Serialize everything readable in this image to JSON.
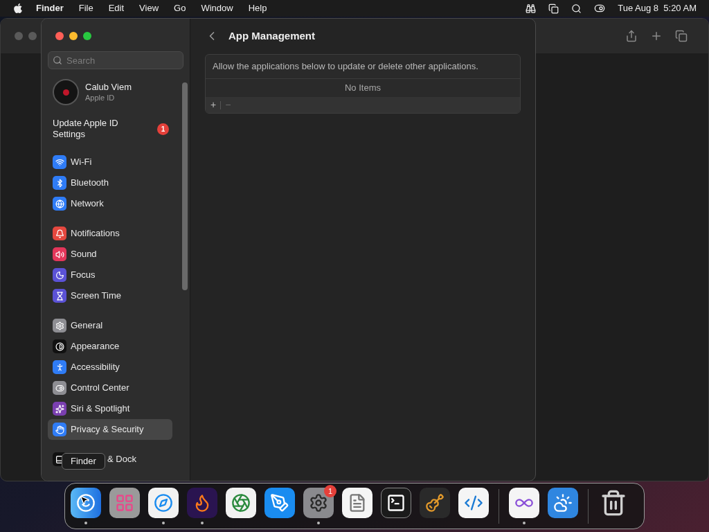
{
  "menu_bar": {
    "app_name": "Finder",
    "menus": [
      "File",
      "Edit",
      "View",
      "Go",
      "Window",
      "Help"
    ],
    "clock": "Tue Aug 8  5:20 AM"
  },
  "settings_window": {
    "search": {
      "placeholder": "Search"
    },
    "account": {
      "name": "Calub Viem",
      "subtitle": "Apple ID"
    },
    "notice": {
      "text": "Update Apple ID Settings",
      "badge": "1"
    },
    "sidebar": {
      "sections": [
        [
          {
            "label": "Wi-Fi",
            "kind": "wifi",
            "color": "#2f7cf6",
            "selected": false
          },
          {
            "label": "Bluetooth",
            "kind": "bluetooth",
            "color": "#2f7cf6",
            "selected": false
          },
          {
            "label": "Network",
            "kind": "network",
            "color": "#2f7cf6",
            "selected": false
          }
        ],
        [
          {
            "label": "Notifications",
            "kind": "notifications",
            "color": "#e5483f",
            "selected": false
          },
          {
            "label": "Sound",
            "kind": "sound",
            "color": "#e3365a",
            "selected": false
          },
          {
            "label": "Focus",
            "kind": "focus",
            "color": "#5b52d6",
            "selected": false
          },
          {
            "label": "Screen Time",
            "kind": "screen_time",
            "color": "#5b52d6",
            "selected": false
          }
        ],
        [
          {
            "label": "General",
            "kind": "general",
            "color": "#8e8e93",
            "selected": false
          },
          {
            "label": "Appearance",
            "kind": "appearance",
            "color": "#111111",
            "selected": false
          },
          {
            "label": "Accessibility",
            "kind": "accessibility",
            "color": "#2f7cf6",
            "selected": false
          },
          {
            "label": "Control Center",
            "kind": "control_center",
            "color": "#8e8e93",
            "selected": false
          },
          {
            "label": "Siri & Spotlight",
            "kind": "siri",
            "color": "#7a3fb0",
            "selected": false
          },
          {
            "label": "Privacy & Security",
            "kind": "privacy",
            "color": "#2f7cf6",
            "selected": true
          }
        ],
        [
          {
            "label": "& Dock",
            "kind": "dock",
            "color": "#111111",
            "selected": false,
            "partly_covered": true
          }
        ]
      ]
    },
    "page": {
      "title": "App Management",
      "description": "Allow the applications below to update or delete other applications.",
      "empty_text": "No Items",
      "add": "+",
      "remove": "−"
    }
  },
  "tooltip": {
    "text": "Finder"
  },
  "dock": {
    "items": [
      {
        "kind": "finder",
        "running": true
      },
      {
        "kind": "launchpad",
        "running": false
      },
      {
        "kind": "safari",
        "running": true
      },
      {
        "kind": "firefox",
        "running": true
      },
      {
        "kind": "chrome",
        "running": false
      },
      {
        "kind": "appstore",
        "running": false
      },
      {
        "kind": "settings",
        "running": true,
        "badge": "1"
      },
      {
        "kind": "textedit",
        "running": false
      },
      {
        "kind": "terminal",
        "running": false
      },
      {
        "kind": "garageband",
        "running": false
      },
      {
        "kind": "vscode",
        "running": false
      },
      {
        "kind": "separator"
      },
      {
        "kind": "visualstudio",
        "running": true
      },
      {
        "kind": "weather",
        "running": false
      },
      {
        "kind": "separator"
      },
      {
        "kind": "trash",
        "running": false
      }
    ]
  }
}
